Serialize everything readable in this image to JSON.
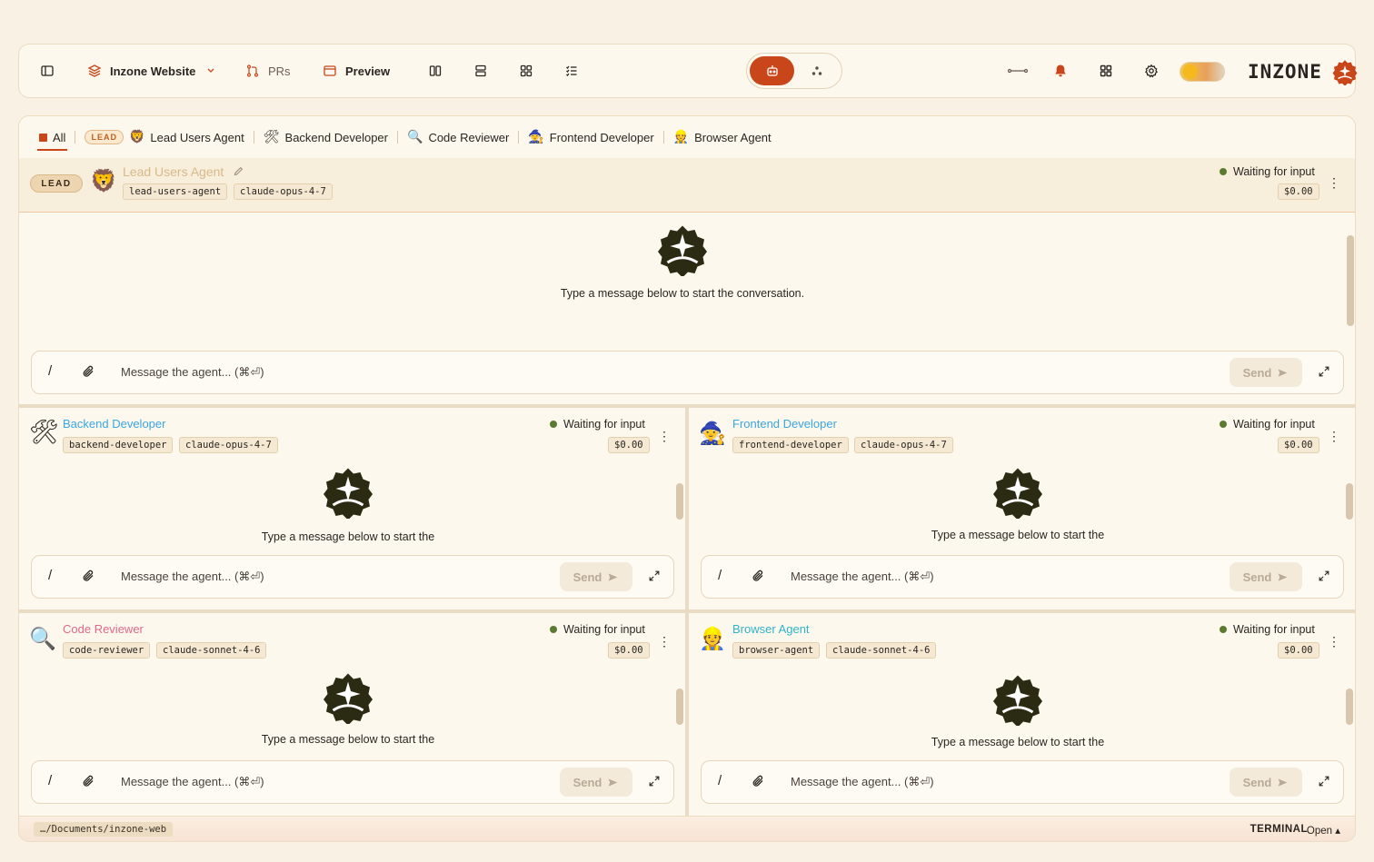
{
  "toolbar": {
    "project_name": "Inzone Website",
    "prs_label": "PRs",
    "preview_label": "Preview",
    "brand": "INZONE"
  },
  "tabs": {
    "all": "All",
    "lead_badge": "LEAD",
    "lead_users_agent": "Lead Users Agent",
    "backend_developer": "Backend Developer",
    "code_reviewer": "Code Reviewer",
    "frontend_developer": "Frontend Developer",
    "browser_agent": "Browser Agent"
  },
  "common": {
    "status": "Waiting for input",
    "cost": "$0.00",
    "empty_full": "Type a message below to start the conversation.",
    "empty_line1": "Type a message below to start the",
    "empty_line2": "conversation.",
    "placeholder": "Message the agent... (⌘⏎)",
    "send": "Send",
    "slash": "/"
  },
  "agents": {
    "lead": {
      "lead_label": "LEAD",
      "name": "Lead Users Agent",
      "slug": "lead-users-agent",
      "model": "claude-opus-4-7",
      "color": "#d9b98a",
      "emoji": "🦁"
    },
    "backend": {
      "name": "Backend Developer",
      "slug": "backend-developer",
      "model": "claude-opus-4-7",
      "color": "#3aa6e0",
      "emoji": "🛠"
    },
    "frontend": {
      "name": "Frontend Developer",
      "slug": "frontend-developer",
      "model": "claude-opus-4-7",
      "color": "#3aa6e0",
      "emoji": "🧙"
    },
    "reviewer": {
      "name": "Code Reviewer",
      "slug": "code-reviewer",
      "model": "claude-sonnet-4-6",
      "color": "#e06a8a",
      "emoji": "🔍"
    },
    "browser": {
      "name": "Browser Agent",
      "slug": "browser-agent",
      "model": "claude-sonnet-4-6",
      "color": "#2fb3c9",
      "emoji": "👷"
    }
  },
  "footer": {
    "path": "…/Documents/inzone-web",
    "terminal": "TERMINAL",
    "open": "Open ▴"
  },
  "colors": {
    "accent": "#c9461a",
    "status_dot": "#5a7a2e",
    "background": "#f9f1e4"
  }
}
